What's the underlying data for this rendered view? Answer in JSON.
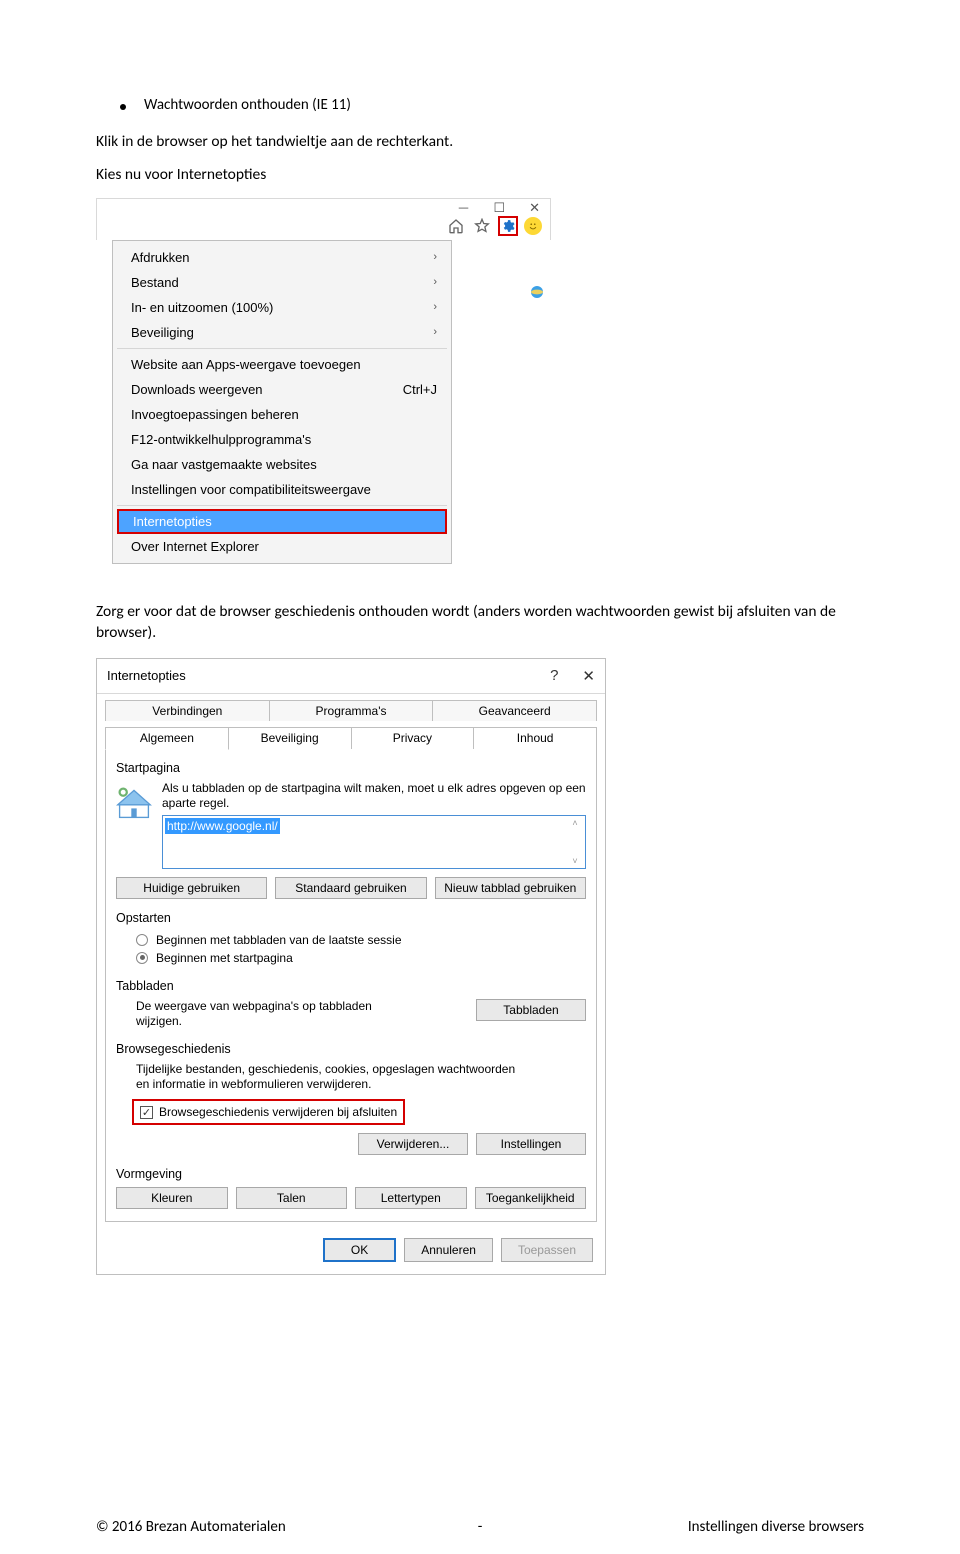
{
  "doc": {
    "bullet_title": "Wachtwoorden onthouden (IE 11)",
    "para1": "Klik in de browser op het tandwieltje aan de rechterkant.",
    "para2": "Kies nu voor Internetopties",
    "para3": "Zorg er voor dat de browser geschiedenis onthouden wordt (anders worden wachtwoorden gewist bij afsluiten van de browser)."
  },
  "ie_menu": {
    "win_minimize": "—",
    "win_maximize": "☐",
    "win_close": "✕",
    "items": [
      {
        "label": "Afdrukken",
        "accel": "›"
      },
      {
        "label": "Bestand",
        "accel": "›"
      },
      {
        "label": "In- en uitzoomen (100%)",
        "accel": "›"
      },
      {
        "label": "Beveiliging",
        "accel": "›"
      }
    ],
    "items2": [
      {
        "label": "Website aan Apps-weergave toevoegen",
        "accel": ""
      },
      {
        "label": "Downloads weergeven",
        "accel": "Ctrl+J"
      },
      {
        "label": "Invoegtoepassingen beheren",
        "accel": ""
      },
      {
        "label": "F12-ontwikkelhulpprogramma's",
        "accel": ""
      },
      {
        "label": "Ga naar vastgemaakte websites",
        "accel": ""
      },
      {
        "label": "Instellingen voor compatibiliteitsweergave",
        "accel": ""
      }
    ],
    "highlighted": "Internetopties",
    "last": "Over Internet Explorer"
  },
  "dlg": {
    "title": "Internetopties",
    "help": "?",
    "close": "✕",
    "tabs_row1": [
      "Verbindingen",
      "Programma's",
      "Geavanceerd"
    ],
    "tabs_row2": [
      "Algemeen",
      "Beveiliging",
      "Privacy",
      "Inhoud"
    ],
    "section_start": "Startpagina",
    "start_desc": "Als u tabbladen op de startpagina wilt maken, moet u elk adres opgeven op een aparte regel.",
    "url": "http://www.google.nl/",
    "btn_huidige": "Huidige gebruiken",
    "btn_standaard": "Standaard gebruiken",
    "btn_nieuw": "Nieuw tabblad gebruiken",
    "section_opstarten": "Opstarten",
    "radio1": "Beginnen met tabbladen van de laatste sessie",
    "radio2": "Beginnen met startpagina",
    "section_tabbladen": "Tabbladen",
    "tabb_desc": "De weergave van webpagina's op tabbladen wijzigen.",
    "btn_tabbladen": "Tabbladen",
    "section_browse": "Browsegeschiedenis",
    "browse_desc": "Tijdelijke bestanden, geschiedenis, cookies, opgeslagen wachtwoorden en informatie in webformulieren verwijderen.",
    "checkbox_label": "Browsegeschiedenis verwijderen bij afsluiten",
    "btn_verwijderen": "Verwijderen...",
    "btn_instellingen": "Instellingen",
    "section_vorm": "Vormgeving",
    "btn_kleuren": "Kleuren",
    "btn_talen": "Talen",
    "btn_letter": "Lettertypen",
    "btn_toegang": "Toegankelijkheid",
    "btn_ok": "OK",
    "btn_ann": "Annuleren",
    "btn_toe": "Toepassen"
  },
  "footer": {
    "left": "© 2016 Brezan Automaterialen",
    "mid": "-",
    "right": "Instellingen diverse browsers"
  }
}
